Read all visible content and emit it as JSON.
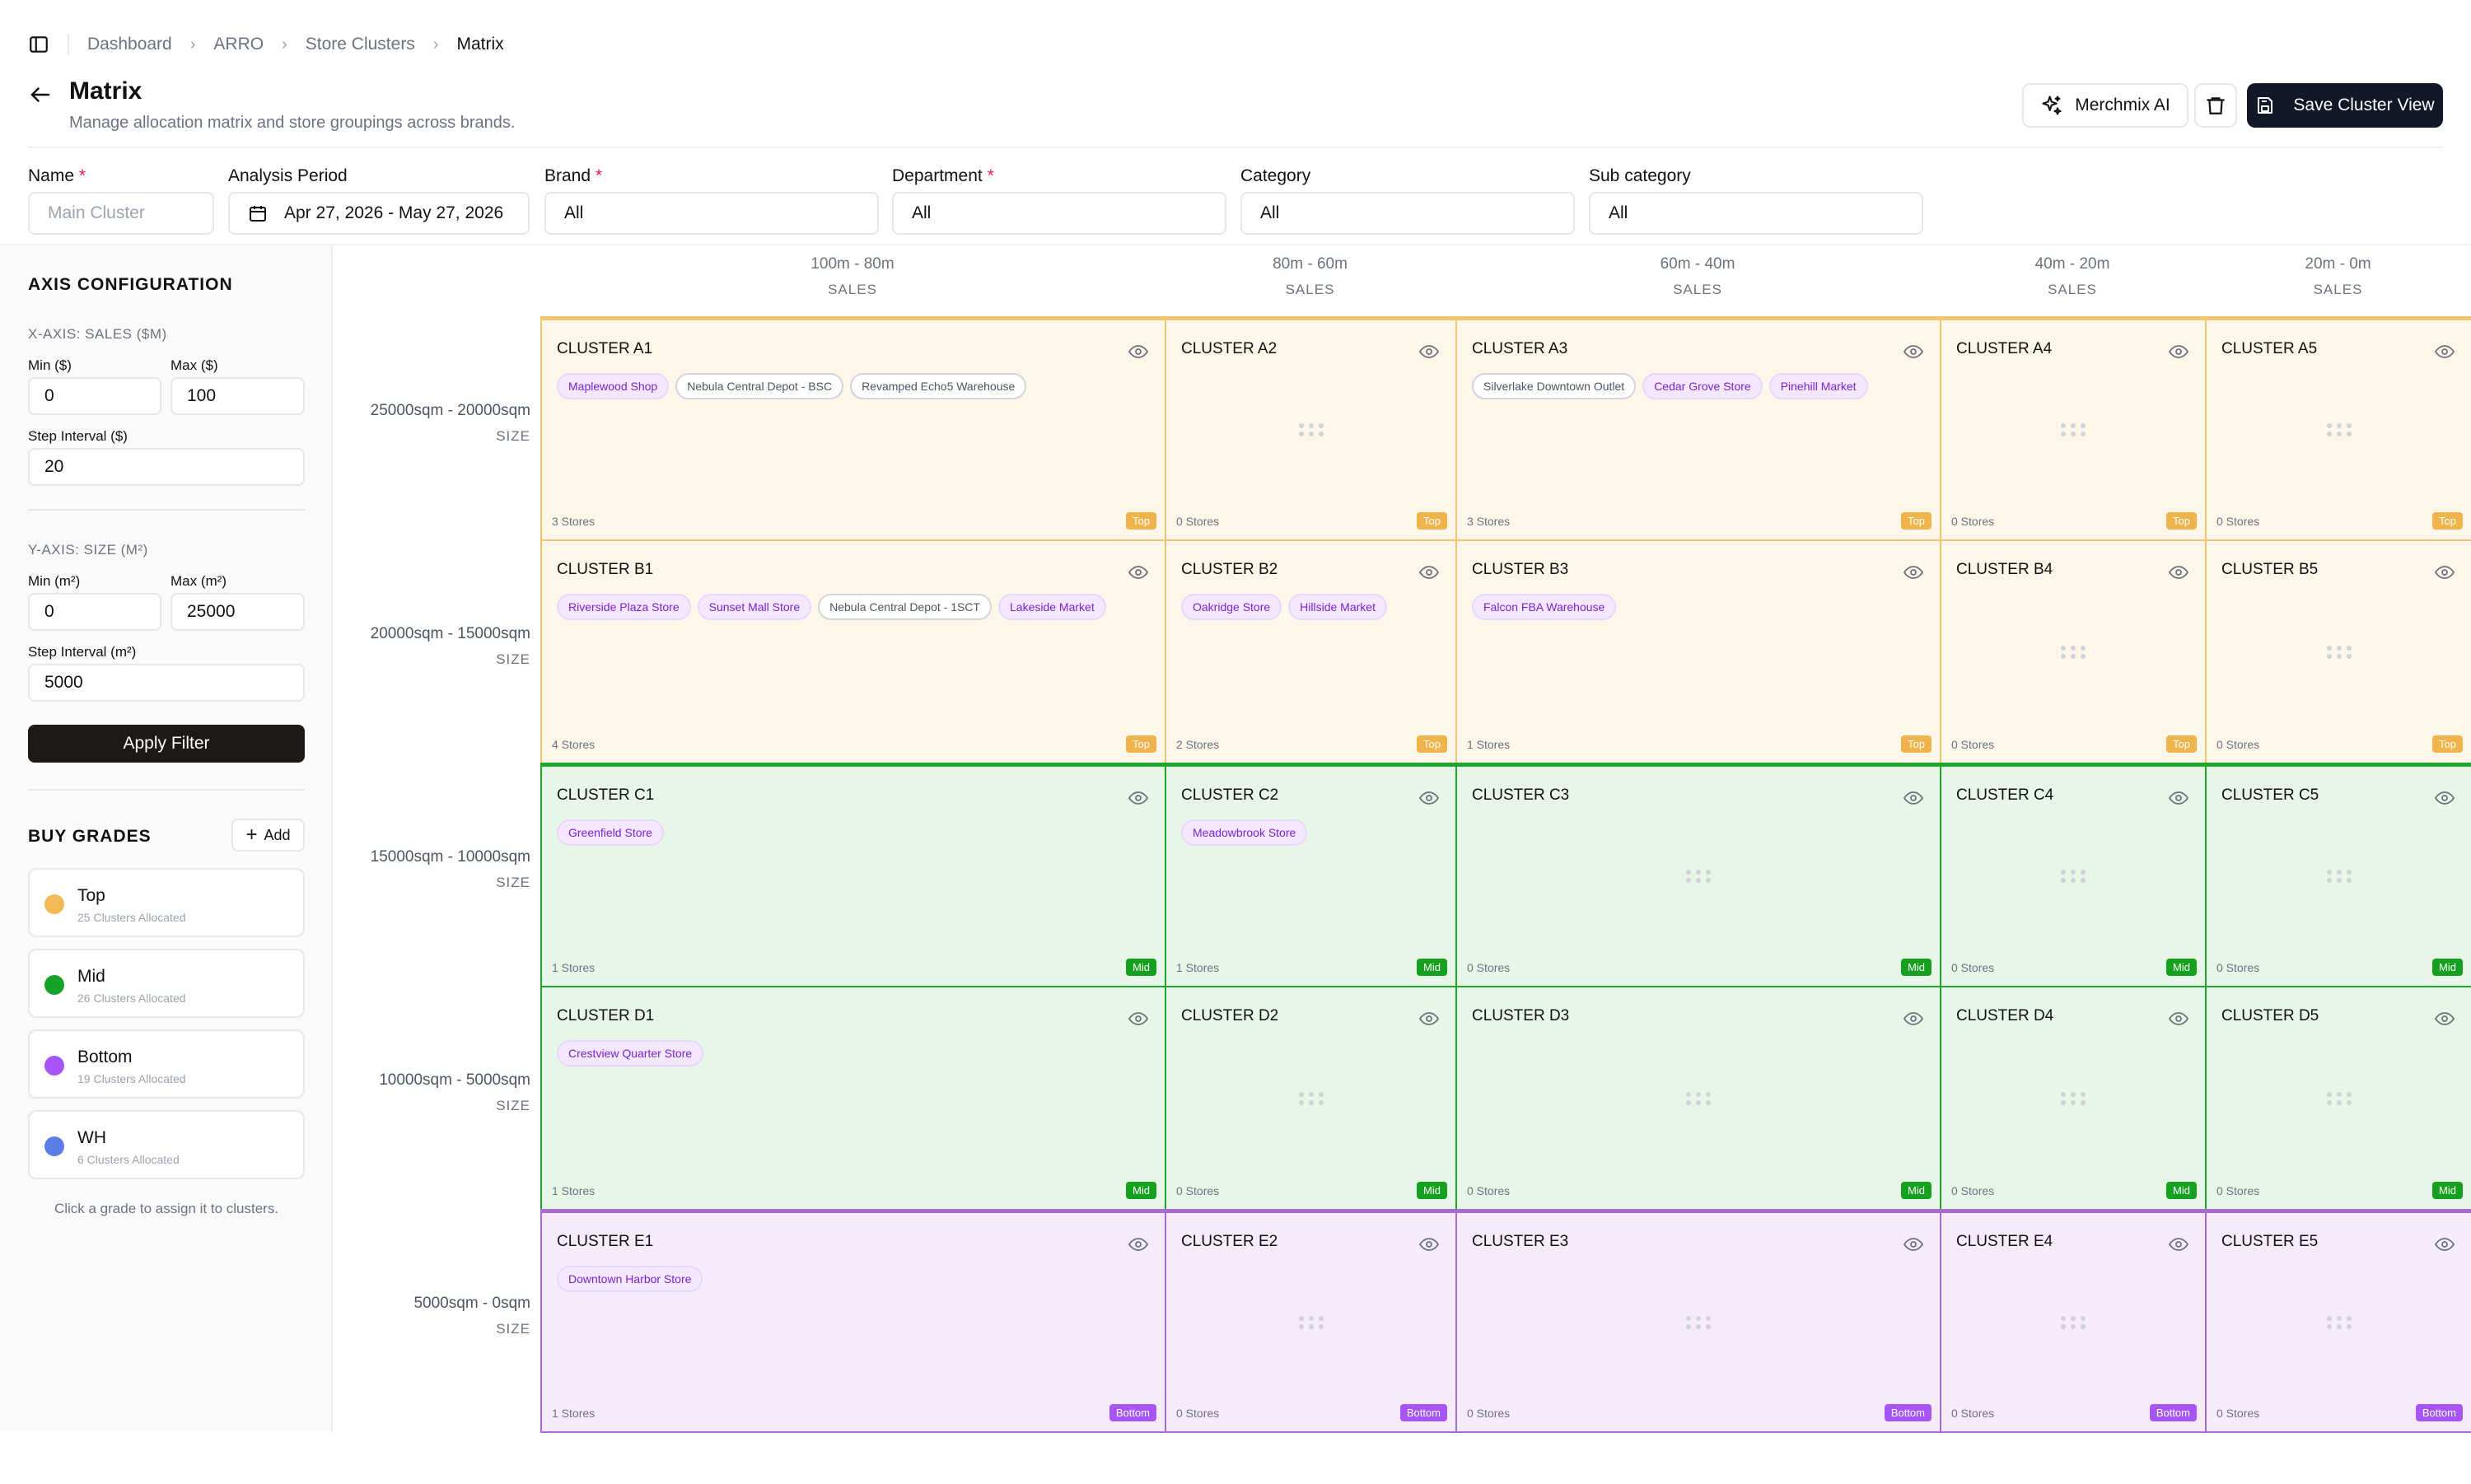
{
  "breadcrumb": [
    "Dashboard",
    "ARRO",
    "Store Clusters",
    "Matrix"
  ],
  "header": {
    "title": "Matrix",
    "subtitle": "Manage allocation matrix and store groupings across brands.",
    "ai_button": "Merchmix AI",
    "save_button": "Save Cluster View"
  },
  "filters": {
    "name": {
      "label": "Name",
      "placeholder": "Main Cluster"
    },
    "period": {
      "label": "Analysis Period",
      "value": "Apr 27, 2026 - May 27, 2026"
    },
    "brand": {
      "label": "Brand",
      "value": "All"
    },
    "department": {
      "label": "Department",
      "value": "All"
    },
    "category": {
      "label": "Category",
      "value": "All"
    },
    "subcategory": {
      "label": "Sub category",
      "value": "All"
    }
  },
  "sidebar": {
    "axis_title": "AXIS CONFIGURATION",
    "x_title": "X-AXIS: SALES ($M)",
    "x_min_label": "Min ($)",
    "x_min": "0",
    "x_max_label": "Max ($)",
    "x_max": "100",
    "x_step_label": "Step Interval ($)",
    "x_step": "20",
    "y_title": "Y-AXIS: SIZE (M²)",
    "y_min_label": "Min (m²)",
    "y_min": "0",
    "y_max_label": "Max (m²)",
    "y_max": "25000",
    "y_step_label": "Step Interval (m²)",
    "y_step": "5000",
    "apply": "Apply Filter",
    "grades_title": "BUY GRADES",
    "add": "Add",
    "grades": [
      {
        "name": "Top",
        "sub": "25 Clusters Allocated",
        "color": "#f2b955"
      },
      {
        "name": "Mid",
        "sub": "26 Clusters Allocated",
        "color": "#16a32a"
      },
      {
        "name": "Bottom",
        "sub": "19 Clusters Allocated",
        "color": "#a855f7"
      },
      {
        "name": "WH",
        "sub": "6 Clusters Allocated",
        "color": "#5b7be6"
      }
    ],
    "hint": "Click a grade to assign it to clusters."
  },
  "matrix": {
    "columns": [
      {
        "range": "100m - 80m",
        "label": "SALES"
      },
      {
        "range": "80m - 60m",
        "label": "SALES"
      },
      {
        "range": "60m - 40m",
        "label": "SALES"
      },
      {
        "range": "40m - 20m",
        "label": "SALES"
      },
      {
        "range": "20m - 0m",
        "label": "SALES"
      }
    ],
    "rows": [
      {
        "range": "25000sqm - 20000sqm",
        "label": "SIZE",
        "grade": "Top",
        "cells": [
          {
            "name": "CLUSTER A1",
            "count": "3 Stores",
            "tags": [
              {
                "t": "Maplewood Shop",
                "s": true
              },
              {
                "t": "Nebula Central Depot - BSC",
                "s": false
              },
              {
                "t": "Revamped Echo5 Warehouse",
                "s": false
              }
            ]
          },
          {
            "name": "CLUSTER A2",
            "count": "0 Stores",
            "tags": []
          },
          {
            "name": "CLUSTER A3",
            "count": "3 Stores",
            "tags": [
              {
                "t": "Silverlake Downtown Outlet",
                "s": false
              },
              {
                "t": "Cedar Grove Store",
                "s": true
              },
              {
                "t": "Pinehill Market",
                "s": true
              }
            ]
          },
          {
            "name": "CLUSTER A4",
            "count": "0 Stores",
            "tags": []
          },
          {
            "name": "CLUSTER A5",
            "count": "0 Stores",
            "tags": []
          }
        ]
      },
      {
        "range": "20000sqm - 15000sqm",
        "label": "SIZE",
        "grade": "Top",
        "cells": [
          {
            "name": "CLUSTER B1",
            "count": "4 Stores",
            "tags": [
              {
                "t": "Riverside Plaza Store",
                "s": true
              },
              {
                "t": "Sunset Mall Store",
                "s": true
              },
              {
                "t": "Nebula Central Depot - 1SCT",
                "s": false
              },
              {
                "t": "Lakeside Market",
                "s": true
              }
            ]
          },
          {
            "name": "CLUSTER B2",
            "count": "2 Stores",
            "tags": [
              {
                "t": "Oakridge Store",
                "s": true
              },
              {
                "t": "Hillside Market",
                "s": true
              }
            ]
          },
          {
            "name": "CLUSTER B3",
            "count": "1 Stores",
            "tags": [
              {
                "t": "Falcon FBA Warehouse",
                "s": true
              }
            ]
          },
          {
            "name": "CLUSTER B4",
            "count": "0 Stores",
            "tags": []
          },
          {
            "name": "CLUSTER B5",
            "count": "0 Stores",
            "tags": []
          }
        ]
      },
      {
        "range": "15000sqm - 10000sqm",
        "label": "SIZE",
        "grade": "Mid",
        "cells": [
          {
            "name": "CLUSTER C1",
            "count": "1 Stores",
            "tags": [
              {
                "t": "Greenfield Store",
                "s": true
              }
            ]
          },
          {
            "name": "CLUSTER C2",
            "count": "1 Stores",
            "tags": [
              {
                "t": "Meadowbrook Store",
                "s": true
              }
            ]
          },
          {
            "name": "CLUSTER C3",
            "count": "0 Stores",
            "tags": []
          },
          {
            "name": "CLUSTER C4",
            "count": "0 Stores",
            "tags": []
          },
          {
            "name": "CLUSTER C5",
            "count": "0 Stores",
            "tags": []
          }
        ]
      },
      {
        "range": "10000sqm - 5000sqm",
        "label": "SIZE",
        "grade": "Mid",
        "cells": [
          {
            "name": "CLUSTER D1",
            "count": "1 Stores",
            "tags": [
              {
                "t": "Crestview Quarter Store",
                "s": true
              }
            ]
          },
          {
            "name": "CLUSTER D2",
            "count": "0 Stores",
            "tags": []
          },
          {
            "name": "CLUSTER D3",
            "count": "0 Stores",
            "tags": []
          },
          {
            "name": "CLUSTER D4",
            "count": "0 Stores",
            "tags": []
          },
          {
            "name": "CLUSTER D5",
            "count": "0 Stores",
            "tags": []
          }
        ]
      },
      {
        "range": "5000sqm - 0sqm",
        "label": "SIZE",
        "grade": "Bottom",
        "cells": [
          {
            "name": "CLUSTER E1",
            "count": "1 Stores",
            "tags": [
              {
                "t": "Downtown Harbor Store",
                "s": true
              }
            ]
          },
          {
            "name": "CLUSTER E2",
            "count": "0 Stores",
            "tags": []
          },
          {
            "name": "CLUSTER E3",
            "count": "0 Stores",
            "tags": []
          },
          {
            "name": "CLUSTER E4",
            "count": "0 Stores",
            "tags": []
          },
          {
            "name": "CLUSTER E5",
            "count": "0 Stores",
            "tags": []
          }
        ]
      }
    ]
  },
  "grade_styles": {
    "Top": {
      "bg": "#fdf6e9",
      "border": "#f0c56e",
      "badge": "#efb44c"
    },
    "Mid": {
      "bg": "#e7f6e6",
      "border": "#1fa52b",
      "badge": "#15a11f"
    },
    "Bottom": {
      "bg": "#f6ebfb",
      "border": "#a76ad6",
      "badge": "#a855f7"
    }
  }
}
